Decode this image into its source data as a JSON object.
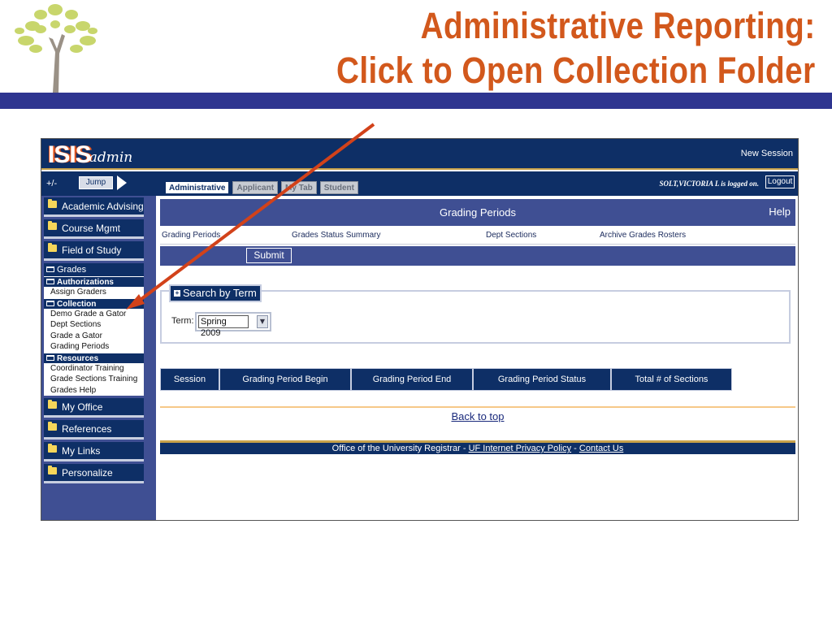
{
  "slide": {
    "title_line1": "Administrative Reporting:",
    "title_line2": "Click to Open Collection Folder",
    "accent_color": "#d2581c",
    "bar_color": "#2e3590"
  },
  "app": {
    "logo_isis": "ISIS",
    "logo_admin": "admin",
    "new_session": "New Session",
    "plus_minus": "+/-",
    "jump_label": "Jump",
    "logged_on": "SOLT,VICTORIA L is logged on.",
    "logout_label": "Logout"
  },
  "tabs": [
    "Administrative",
    "Applicant",
    "My Tab",
    "Student"
  ],
  "sidebar": {
    "top_items": [
      "Academic Advising",
      "Course Mgmt",
      "Field of Study"
    ],
    "grades": {
      "label": "Grades",
      "authorizations": {
        "label": "Authorizations",
        "items": [
          "Assign Graders"
        ]
      },
      "collection": {
        "label": "Collection",
        "items": [
          "Demo Grade a Gator",
          "Dept Sections",
          "Grade a Gator",
          "Grading Periods"
        ]
      },
      "resources": {
        "label": "Resources",
        "items": [
          "Coordinator Training",
          "Grade Sections Training",
          "Grades Help"
        ]
      }
    },
    "bottom_items": [
      "My Office",
      "References",
      "My Links",
      "Personalize"
    ]
  },
  "page": {
    "title": "Grading Periods",
    "help": "Help",
    "links": [
      "Grading Periods",
      "Grades Status Summary",
      "Dept Sections",
      "Archive Grades Rosters"
    ],
    "submit_label": "Submit",
    "search_legend": "Search by Term",
    "term_label": "Term:",
    "term_value": "Spring 2009",
    "columns": [
      "Session",
      "Grading Period Begin",
      "Grading Period End",
      "Grading Period Status",
      "Total # of Sections"
    ],
    "back_to_top": "Back to top",
    "footer": {
      "text": "Office of the University Registrar - ",
      "privacy": "UF Internet Privacy Policy",
      "sep": " - ",
      "contact": "Contact Us"
    }
  }
}
